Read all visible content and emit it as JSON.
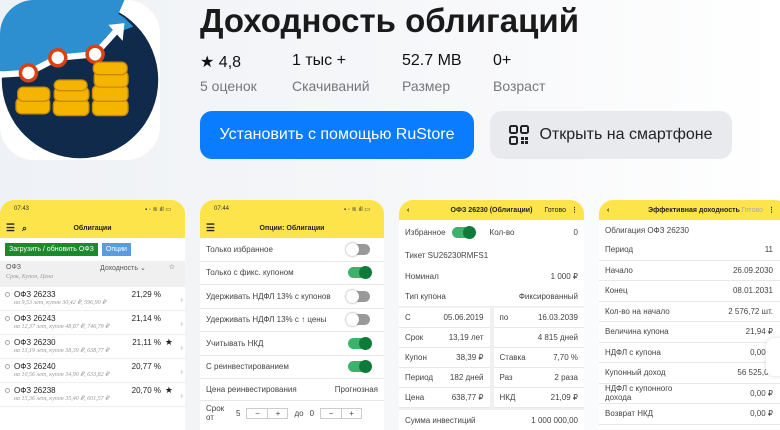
{
  "app": {
    "title": "Доходность облигаций"
  },
  "stats": [
    {
      "value": "4,8",
      "label": "5 оценок",
      "icon": "star"
    },
    {
      "value": "1 тыс +",
      "label": "Скачиваний"
    },
    {
      "value": "52.7 MB",
      "label": "Размер"
    },
    {
      "value": "0+",
      "label": "Возраст"
    }
  ],
  "actions": {
    "install": "Установить с помощью RuStore",
    "open": "Открыть на смартфоне"
  },
  "colors": {
    "install": "#0a7cff",
    "header_yellow": "#fde44a",
    "toggle_on": "#0f7a3a"
  },
  "s1": {
    "time": "07:43",
    "title": "Облигации",
    "load": "Загрузить / обновить ОФЗ",
    "options": "Опции",
    "col1": "ОФЗ",
    "col1sub": "Срок, Купон, Цена",
    "col2": "Доходность",
    "rows": [
      {
        "name": "ОФЗ 26233",
        "sub": "на 9,53 лет, купон 30,42 ₽, 596,90 ₽",
        "y": "21,29 %",
        "fav": false
      },
      {
        "name": "ОФЗ 26243",
        "sub": "на 12,37 лет, купон 48,87 ₽, 746,79 ₽",
        "y": "21,14 %",
        "fav": false
      },
      {
        "name": "ОФЗ 26230",
        "sub": "на 13,19 лет, купон 38,39 ₽, 638,77 ₽",
        "y": "21,11 %",
        "fav": true
      },
      {
        "name": "ОФЗ 26240",
        "sub": "на 10,56 лет, купон 34,90 ₽, 633,82 ₽",
        "y": "20,77 %",
        "fav": false
      },
      {
        "name": "ОФЗ 26238",
        "sub": "на 15,36 лет, купон 35,40 ₽, 601,57 ₽",
        "y": "20,70 %",
        "fav": true
      }
    ]
  },
  "s2": {
    "time": "07:44",
    "title": "Опции: Облигации",
    "toggles": [
      {
        "label": "Только избранное",
        "on": false
      },
      {
        "label": "Только с фикс. купоном",
        "on": true
      },
      {
        "label": "Удерживать НДФЛ 13% с купонов",
        "on": false
      },
      {
        "label": "Удерживать НДФЛ 13% с ↑ цены",
        "on": false
      },
      {
        "label": "Учитывать НКД",
        "on": true
      },
      {
        "label": "С реинвестированием",
        "on": true
      }
    ],
    "reinvest_label": "Цена реинвестирования",
    "reinvest_value": "Прогнозная",
    "term_label": "Срок от",
    "term_from": "5",
    "to_label": "до",
    "term_to": "0"
  },
  "s3": {
    "title": "ОФЗ 26230 (Облигации)",
    "done": "Готово",
    "fav": "Избранное",
    "qty_label": "Кол-во",
    "qty": "0",
    "ticker": "Тикет SU26230RMFS1",
    "nominal_label": "Номинал",
    "nominal": "1 000 ₽",
    "ctype_label": "Тип купона",
    "ctype": "Фиксированный",
    "left": [
      [
        "С",
        "05.06.2019"
      ],
      [
        "Срок",
        "13,19 лет"
      ],
      [
        "Купон",
        "38,39 ₽"
      ],
      [
        "Период",
        "182 дней"
      ],
      [
        "Цена",
        "638,77 ₽"
      ]
    ],
    "right": [
      [
        "по",
        "16.03.2039"
      ],
      [
        "",
        "4 815 дней"
      ],
      [
        "Ставка",
        "7,70 %"
      ],
      [
        "Раз",
        "2 раза"
      ],
      [
        "НКД",
        "21,09 ₽"
      ]
    ],
    "sum_label": "Сумма инвестиций",
    "sum": "1 000 000,00"
  },
  "s4": {
    "title": "Эффективная доходность",
    "done": "Готово",
    "bond": "Облигация ОФЗ 26230",
    "rows": [
      [
        "Период",
        "11"
      ],
      [
        "Начало",
        "26.09.2030"
      ],
      [
        "Конец",
        "08.01.2031"
      ],
      [
        "Кол-во на начало",
        "2 576,72 шт."
      ],
      [
        "Величина купона",
        "21,94 ₽"
      ],
      [
        "НДФЛ с купона",
        "0,00 ₽"
      ],
      [
        "Купонный доход",
        "56 525,00"
      ],
      [
        "НДФЛ с купонного дохода",
        "0,00 ₽"
      ],
      [
        "Возврат НКД",
        "0,00 ₽"
      ]
    ]
  }
}
